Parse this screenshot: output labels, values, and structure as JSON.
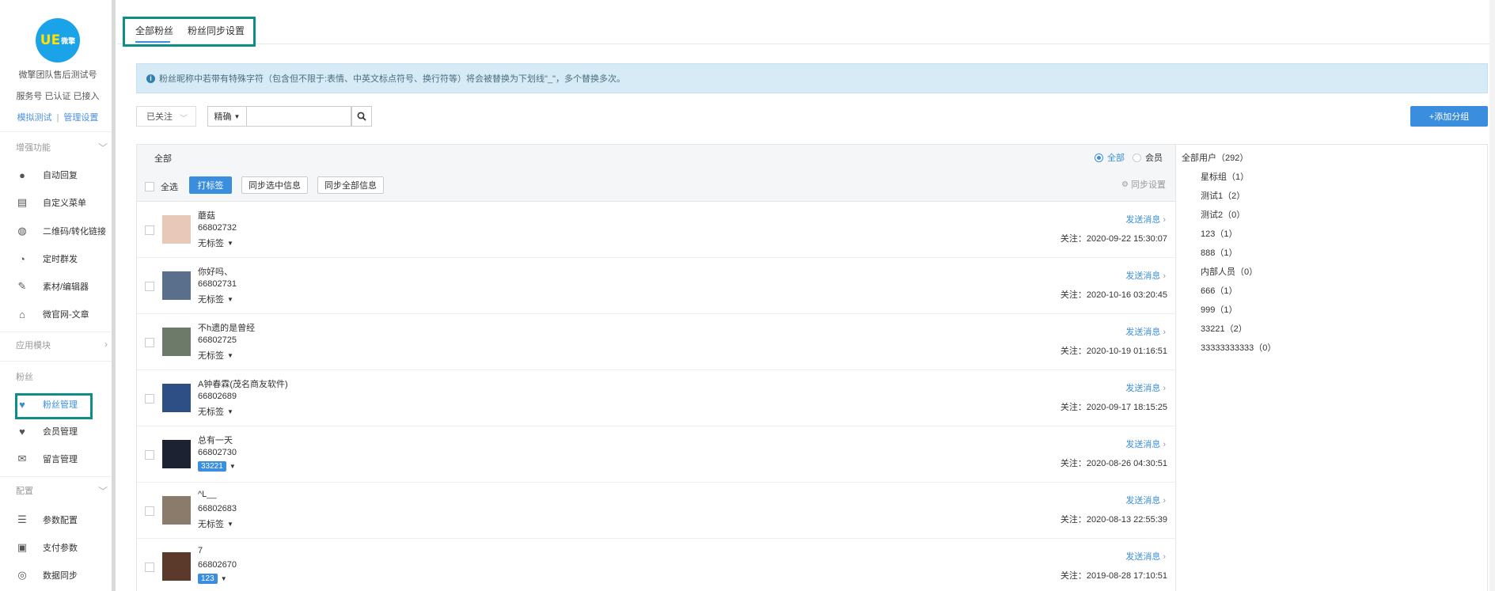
{
  "sidebar": {
    "logo_text": "UE",
    "logo_sub": "微擎",
    "account_name": "微擎团队售后测试号",
    "account_status": "服务号 已认证 已接入",
    "links": {
      "simulate": "模拟测试",
      "separator": "|",
      "manage": "管理设置"
    },
    "sections": [
      {
        "title": "增强功能"
      },
      {
        "title": "应用模块"
      },
      {
        "title": "粉丝"
      },
      {
        "title": "配置"
      }
    ],
    "items": [
      {
        "label": "自动回复",
        "icon": "chat-icon",
        "glyph": "●"
      },
      {
        "label": "自定义菜单",
        "icon": "menu-doc-icon",
        "glyph": "▤"
      },
      {
        "label": "二维码/转化链接",
        "icon": "qrcode-icon",
        "glyph": "◍"
      },
      {
        "label": "定时群发",
        "icon": "clock-icon",
        "glyph": "◔"
      },
      {
        "label": "素材/编辑器",
        "icon": "edit-icon",
        "glyph": "✎"
      },
      {
        "label": "微官网-文章",
        "icon": "home-icon",
        "glyph": "⌂"
      },
      {
        "label": "粉丝管理",
        "icon": "fans-icon",
        "glyph": "♥"
      },
      {
        "label": "会员管理",
        "icon": "heart-icon",
        "glyph": "♥"
      },
      {
        "label": "留言管理",
        "icon": "mail-icon",
        "glyph": "✉"
      },
      {
        "label": "参数配置",
        "icon": "list-icon",
        "glyph": "☰"
      },
      {
        "label": "支付参数",
        "icon": "wallet-icon",
        "glyph": "▣"
      },
      {
        "label": "数据同步",
        "icon": "sync-icon",
        "glyph": "◎"
      }
    ]
  },
  "tabs": [
    {
      "label": "全部粉丝"
    },
    {
      "label": "粉丝同步设置"
    }
  ],
  "notice": {
    "icon": "info-icon",
    "text": "粉丝昵称中若带有特殊字符（包含但不限于:表情、中英文标点符号、换行符等）将会被替换为下划线\"_\"，多个替换多次。"
  },
  "filter": {
    "status_select": "已关注",
    "match_mode": "精确",
    "search_value": ""
  },
  "add_group_button": "+添加分组",
  "list": {
    "header_label": "全部",
    "radio_options": [
      {
        "label": "全部",
        "selected": true
      },
      {
        "label": "会员",
        "selected": false
      }
    ],
    "select_all": "全选",
    "tag_button": "打标签",
    "sync_selected": "同步选中信息",
    "sync_all": "同步全部信息",
    "sync_settings": "同步设置",
    "send_label": "发送消息",
    "rows": [
      {
        "nick": "蘑菇",
        "id": "66802732",
        "tag": "无标签",
        "tag_badge": false,
        "follow": "关注：2020-09-22 15:30:07",
        "avatar_color": "#e8c8b8"
      },
      {
        "nick": "你好吗、",
        "id": "66802731",
        "tag": "无标签",
        "tag_badge": false,
        "follow": "关注：2020-10-16 03:20:45",
        "avatar_color": "#5a6f8c"
      },
      {
        "nick": "不h遗的是曾经",
        "id": "66802725",
        "tag": "无标签",
        "tag_badge": false,
        "follow": "关注：2020-10-19 01:16:51",
        "avatar_color": "#6d7a6a"
      },
      {
        "nick": "A钟春霖(茂名商友软件)",
        "id": "66802689",
        "tag": "无标签",
        "tag_badge": false,
        "follow": "关注：2020-09-17 18:15:25",
        "avatar_color": "#2e4f86"
      },
      {
        "nick": "总有一天",
        "id": "66802730",
        "tag": "33221",
        "tag_badge": true,
        "follow": "关注：2020-08-26 04:30:51",
        "avatar_color": "#1d2233"
      },
      {
        "nick": "^L__",
        "id": "66802683",
        "tag": "无标签",
        "tag_badge": false,
        "follow": "关注：2020-08-13 22:55:39",
        "avatar_color": "#8a7b6b"
      },
      {
        "nick": "7",
        "id": "66802670",
        "tag": "123",
        "tag_badge": true,
        "follow": "关注：2019-08-28 17:10:51",
        "avatar_color": "#5b3a2c"
      }
    ]
  },
  "groups": [
    {
      "label": "全部用户（292）"
    },
    {
      "label": "星标组（1）"
    },
    {
      "label": "测试1（2）"
    },
    {
      "label": "测试2（0）"
    },
    {
      "label": "123（1）"
    },
    {
      "label": "888（1）"
    },
    {
      "label": "内部人员（0）"
    },
    {
      "label": "666（1）"
    },
    {
      "label": "999（1）"
    },
    {
      "label": "33221（2）"
    },
    {
      "label": "33333333333（0）"
    }
  ],
  "colors": {
    "accent": "#3b8ede",
    "highlight_box": "#0e8e86",
    "notice_bg": "#d6ebf5"
  }
}
